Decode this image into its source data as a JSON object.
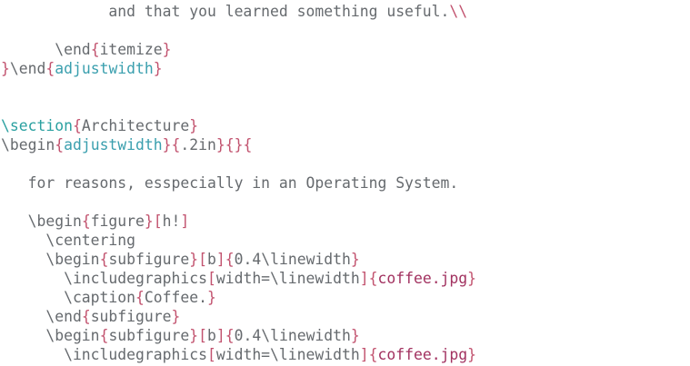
{
  "editor": {
    "colors": {
      "text": "#666a6e",
      "command_teal": "#2aa0a0",
      "brace_pink": "#c2536f",
      "argument_blue": "#3a9fae",
      "filename_magenta": "#a23260"
    },
    "lines": [
      {
        "segments": [
          {
            "t": "            and that you learned something useful.",
            "c": "pl"
          },
          {
            "t": "\\\\",
            "c": "br"
          }
        ]
      },
      {
        "segments": []
      },
      {
        "segments": [
          {
            "t": "      \\end",
            "c": "pl"
          },
          {
            "t": "{",
            "c": "br"
          },
          {
            "t": "itemize",
            "c": "pl"
          },
          {
            "t": "}",
            "c": "br"
          }
        ]
      },
      {
        "segments": [
          {
            "t": "}",
            "c": "br"
          },
          {
            "t": "\\end",
            "c": "pl"
          },
          {
            "t": "{",
            "c": "br"
          },
          {
            "t": "adjustwidth",
            "c": "arg"
          },
          {
            "t": "}",
            "c": "br"
          }
        ]
      },
      {
        "segments": []
      },
      {
        "segments": []
      },
      {
        "segments": [
          {
            "t": "\\section",
            "c": "kw"
          },
          {
            "t": "{",
            "c": "br"
          },
          {
            "t": "Architecture",
            "c": "pl"
          },
          {
            "t": "}",
            "c": "br"
          }
        ]
      },
      {
        "segments": [
          {
            "t": "\\begin",
            "c": "pl"
          },
          {
            "t": "{",
            "c": "br"
          },
          {
            "t": "adjustwidth",
            "c": "arg"
          },
          {
            "t": "}{",
            "c": "br"
          },
          {
            "t": ".2in",
            "c": "pl"
          },
          {
            "t": "}{}{",
            "c": "br"
          }
        ]
      },
      {
        "segments": []
      },
      {
        "segments": [
          {
            "t": "   for reasons, esspecially in an Operating System.",
            "c": "pl"
          }
        ]
      },
      {
        "segments": []
      },
      {
        "segments": [
          {
            "t": "   \\begin",
            "c": "pl"
          },
          {
            "t": "{",
            "c": "br"
          },
          {
            "t": "figure",
            "c": "pl"
          },
          {
            "t": "}[",
            "c": "br"
          },
          {
            "t": "h!",
            "c": "pl"
          },
          {
            "t": "]",
            "c": "br"
          }
        ]
      },
      {
        "segments": [
          {
            "t": "     \\centering",
            "c": "pl"
          }
        ]
      },
      {
        "segments": [
          {
            "t": "     \\begin",
            "c": "pl"
          },
          {
            "t": "{",
            "c": "br"
          },
          {
            "t": "subfigure",
            "c": "pl"
          },
          {
            "t": "}[",
            "c": "br"
          },
          {
            "t": "b",
            "c": "pl"
          },
          {
            "t": "]{",
            "c": "br"
          },
          {
            "t": "0.4\\linewidth",
            "c": "pl"
          },
          {
            "t": "}",
            "c": "br"
          }
        ]
      },
      {
        "segments": [
          {
            "t": "       \\includegraphics",
            "c": "pl"
          },
          {
            "t": "[",
            "c": "br"
          },
          {
            "t": "width=\\linewidth",
            "c": "pl"
          },
          {
            "t": "]{",
            "c": "br"
          },
          {
            "t": "coffee.jpg",
            "c": "str"
          },
          {
            "t": "}",
            "c": "br"
          }
        ]
      },
      {
        "segments": [
          {
            "t": "       \\caption",
            "c": "pl"
          },
          {
            "t": "{",
            "c": "br"
          },
          {
            "t": "Coffee.",
            "c": "pl"
          },
          {
            "t": "}",
            "c": "br"
          }
        ]
      },
      {
        "segments": [
          {
            "t": "     \\end",
            "c": "pl"
          },
          {
            "t": "{",
            "c": "br"
          },
          {
            "t": "subfigure",
            "c": "pl"
          },
          {
            "t": "}",
            "c": "br"
          }
        ]
      },
      {
        "segments": [
          {
            "t": "     \\begin",
            "c": "pl"
          },
          {
            "t": "{",
            "c": "br"
          },
          {
            "t": "subfigure",
            "c": "pl"
          },
          {
            "t": "}[",
            "c": "br"
          },
          {
            "t": "b",
            "c": "pl"
          },
          {
            "t": "]{",
            "c": "br"
          },
          {
            "t": "0.4\\linewidth",
            "c": "pl"
          },
          {
            "t": "}",
            "c": "br"
          }
        ]
      },
      {
        "segments": [
          {
            "t": "       \\includegraphics",
            "c": "pl"
          },
          {
            "t": "[",
            "c": "br"
          },
          {
            "t": "width=\\linewidth",
            "c": "pl"
          },
          {
            "t": "]{",
            "c": "br"
          },
          {
            "t": "coffee.jpg",
            "c": "str"
          },
          {
            "t": "}",
            "c": "br"
          }
        ]
      }
    ]
  }
}
